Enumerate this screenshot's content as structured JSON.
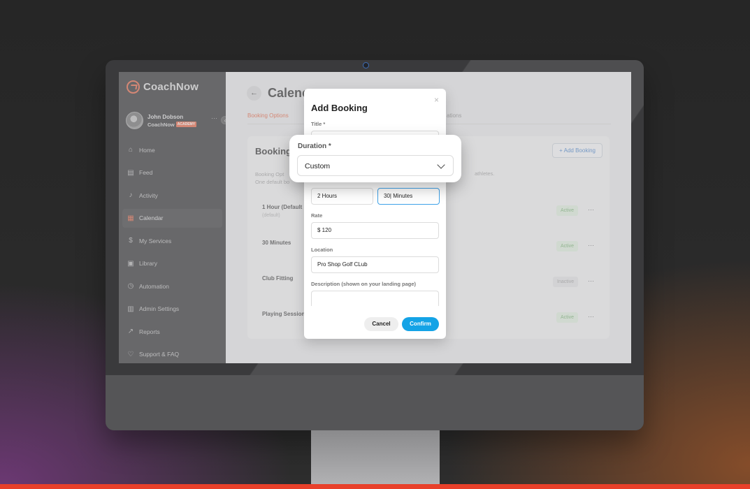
{
  "app": {
    "logo_text": "CoachNow",
    "user_name": "John Dobson",
    "org_name": "CoachNow",
    "org_badge": "ACADEMY",
    "more_symbol": "···",
    "collapse_symbol": "‹"
  },
  "sidebar": {
    "items": [
      {
        "label": "Home",
        "icon": "home-icon",
        "glyph": "⌂"
      },
      {
        "label": "Feed",
        "icon": "feed-icon",
        "glyph": "▤"
      },
      {
        "label": "Activity",
        "icon": "bell-icon",
        "glyph": "♪"
      },
      {
        "label": "Calendar",
        "icon": "calendar-icon",
        "glyph": "▦"
      },
      {
        "label": "My Services",
        "icon": "dollar-icon",
        "glyph": "$"
      },
      {
        "label": "Library",
        "icon": "library-icon",
        "glyph": "▣"
      },
      {
        "label": "Automation",
        "icon": "timer-icon",
        "glyph": "◷"
      },
      {
        "label": "Admin Settings",
        "icon": "building-icon",
        "glyph": "▥"
      },
      {
        "label": "Reports",
        "icon": "chart-icon",
        "glyph": "↗"
      },
      {
        "label": "Support & FAQ",
        "icon": "heart-icon",
        "glyph": "♡"
      }
    ]
  },
  "main": {
    "back_symbol": "←",
    "title": "Calenc",
    "tab_active": "Booking Options",
    "tab_other": "ations",
    "card_title": "Booking",
    "add_button": "+ Add Booking",
    "desc_line1": "Booking Opt",
    "desc_line2": "One default bo",
    "desc_tail": "athletes.",
    "rows": [
      {
        "title": "1 Hour (Default",
        "sub": "(default)",
        "status": "Active"
      },
      {
        "title": "30 Minutes",
        "sub": "",
        "status": "Active"
      },
      {
        "title": "Club Fitting",
        "sub": "",
        "status": "Inactive"
      },
      {
        "title": "Playing Session",
        "sub": "",
        "status": "Active"
      }
    ],
    "row_more": "···"
  },
  "modal": {
    "title": "Add Booking",
    "close_symbol": "×",
    "title_label": "Title *",
    "hours_value": "2  Hours",
    "minutes_value": "30| Minutes",
    "rate_label": "Rate",
    "rate_value": "$ 120",
    "location_label": "Location",
    "location_value": "Pro Shop Golf CLub",
    "description_label": "Description (shown on your landing page)",
    "cancel_label": "Cancel",
    "confirm_label": "Confirm"
  },
  "callout": {
    "label": "Duration *",
    "value": "Custom"
  },
  "colors": {
    "brand": "#e55a37",
    "confirm": "#14a3e6",
    "active": "#6fae6a"
  }
}
